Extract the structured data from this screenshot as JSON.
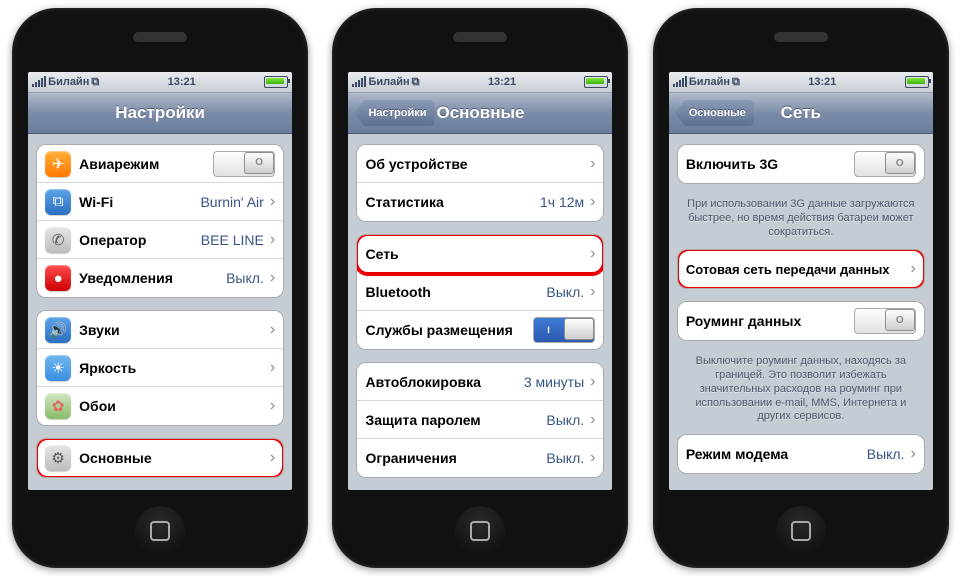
{
  "status": {
    "carrier": "Билайн",
    "time": "13:21"
  },
  "phone1": {
    "title": "Настройки",
    "group1": [
      {
        "label": "Авиарежим",
        "type": "toggle",
        "on": false,
        "icon_bg": "linear-gradient(#ffae3b,#ff7a00)",
        "icon": "✈",
        "name": "airplane-mode"
      },
      {
        "label": "Wi-Fi",
        "value": "Burnin' Air",
        "icon_bg": "linear-gradient(#5aa4e6,#2b6fc2)",
        "icon": "⧉",
        "name": "wifi"
      },
      {
        "label": "Оператор",
        "value": "BEE LINE",
        "icon_bg": "linear-gradient(#e6e6e6,#bcbcbc)",
        "icon": "✆",
        "icon_color": "#555",
        "name": "carrier"
      },
      {
        "label": "Уведомления",
        "value": "Выкл.",
        "icon_bg": "linear-gradient(#ff4d4d,#cc0000)",
        "icon": "●",
        "name": "notifications"
      }
    ],
    "group2": [
      {
        "label": "Звуки",
        "icon_bg": "linear-gradient(#5aa4e6,#2b6fc2)",
        "icon": "🔊",
        "name": "sounds"
      },
      {
        "label": "Яркость",
        "icon_bg": "linear-gradient(#6fb6f0,#3a8fe0)",
        "icon": "☀",
        "name": "brightness"
      },
      {
        "label": "Обои",
        "icon_bg": "linear-gradient(#d4e6c4,#88bb66)",
        "icon": "✿",
        "icon_color": "#d66",
        "name": "wallpaper"
      }
    ],
    "group3": [
      {
        "label": "Основные",
        "icon_bg": "linear-gradient(#e6e6e6,#bcbcbc)",
        "icon": "⚙",
        "icon_color": "#555",
        "name": "general",
        "highlight": true
      }
    ]
  },
  "phone2": {
    "back": "Настройки",
    "title": "Основные",
    "group1": [
      {
        "label": "Об устройстве",
        "name": "about"
      },
      {
        "label": "Статистика",
        "value": "1ч 12м",
        "name": "usage"
      }
    ],
    "group2": [
      {
        "label": "Сеть",
        "name": "network",
        "highlight": true
      },
      {
        "label": "Bluetooth",
        "value": "Выкл.",
        "name": "bluetooth"
      },
      {
        "label": "Службы размещения",
        "type": "toggle",
        "on": true,
        "name": "location-services"
      }
    ],
    "group3": [
      {
        "label": "Автоблокировка",
        "value": "3 минуты",
        "name": "auto-lock"
      },
      {
        "label": "Защита паролем",
        "value": "Выкл.",
        "name": "passcode-lock"
      },
      {
        "label": "Ограничения",
        "value": "Выкл.",
        "name": "restrictions"
      }
    ]
  },
  "phone3": {
    "back": "Основные",
    "title": "Сеть",
    "group1": [
      {
        "label": "Включить 3G",
        "type": "toggle",
        "on": false,
        "name": "enable-3g"
      }
    ],
    "note1": "При использовании 3G данные загружаются быстрее, но время действия батареи может сократиться.",
    "group2": [
      {
        "label": "Сотовая сеть передачи данных",
        "name": "cellular-data-network",
        "highlight": true,
        "small": true
      }
    ],
    "group3": [
      {
        "label": "Роуминг данных",
        "type": "toggle",
        "on": false,
        "name": "data-roaming"
      }
    ],
    "note2": "Выключите роуминг данных, находясь за границей. Это позволит избежать значительных расходов на роуминг при использовании e-mail, MMS, Интернета и других сервисов.",
    "group4": [
      {
        "label": "Режим модема",
        "value": "Выкл.",
        "name": "internet-tethering"
      }
    ]
  }
}
